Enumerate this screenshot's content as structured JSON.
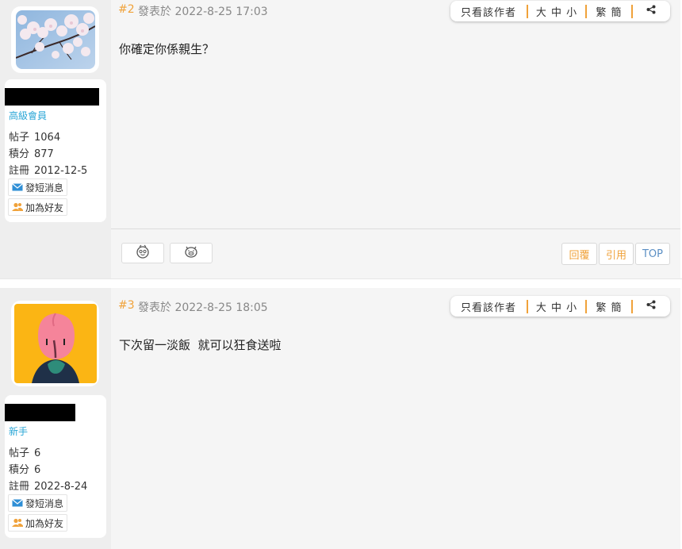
{
  "colors": {
    "accent": "#f0a23a",
    "rank": "#29a6d6",
    "top_button": "#5b8fc4"
  },
  "posts": [
    {
      "number": "#2",
      "date": "發表於 2022-8-25 17:03",
      "rank": "高級會員",
      "stats": [
        {
          "label": "帖子",
          "value": "1064"
        },
        {
          "label": "積分",
          "value": "877"
        },
        {
          "label": "註冊",
          "value": "2012-12-5"
        }
      ],
      "pm_label": "發短消息",
      "friend_label": "加為好友",
      "toolbar": {
        "author_only": "只看該作者",
        "size": "大 中 小",
        "convert": "繁 簡"
      },
      "content": "你確定你係親生？",
      "reply_label": "回覆",
      "quote_label": "引用",
      "top_label": "TOP"
    },
    {
      "number": "#3",
      "date": "發表於 2022-8-25 18:05",
      "rank": "新手",
      "stats": [
        {
          "label": "帖子",
          "value": "6"
        },
        {
          "label": "積分",
          "value": "6"
        },
        {
          "label": "註冊",
          "value": "2022-8-24"
        }
      ],
      "pm_label": "發短消息",
      "friend_label": "加為好友",
      "toolbar": {
        "author_only": "只看該作者",
        "size": "大 中 小",
        "convert": "繁 簡"
      },
      "content": "下次留一淡飯  就可以狂食送啦"
    }
  ]
}
